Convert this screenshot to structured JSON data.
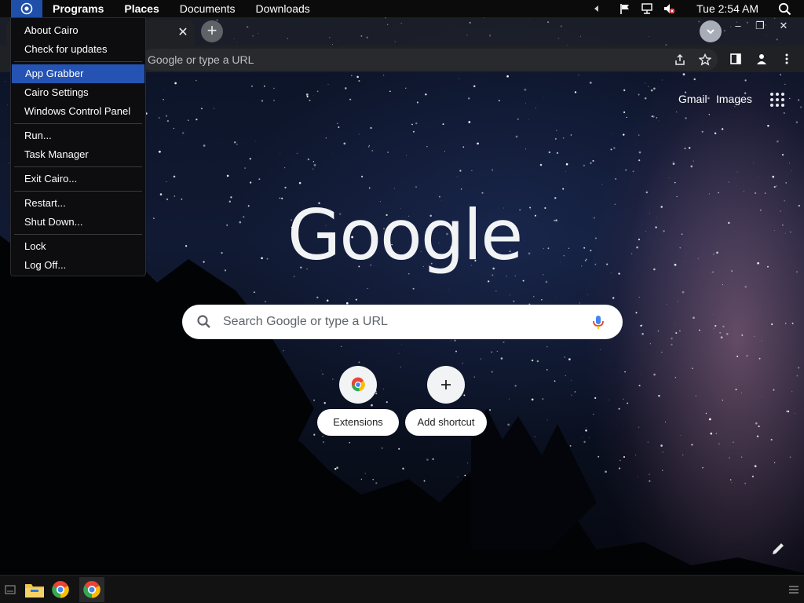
{
  "menubar": {
    "items": [
      "Programs",
      "Places",
      "Documents",
      "Downloads"
    ],
    "clock": "Tue 2:54 AM",
    "icons": [
      "cairo-logo-icon",
      "tray-expand-icon",
      "action-center-flag-icon",
      "network-icon",
      "volume-muted-icon",
      "search-icon"
    ]
  },
  "cairo_menu": {
    "groups": [
      [
        "About Cairo",
        "Check for updates"
      ],
      [
        "App Grabber",
        "Cairo Settings",
        "Windows Control Panel"
      ],
      [
        "Run...",
        "Task Manager"
      ],
      [
        "Exit Cairo..."
      ],
      [
        "Restart...",
        "Shut Down..."
      ],
      [
        "Lock",
        "Log Off..."
      ]
    ],
    "highlighted": "App Grabber"
  },
  "chrome": {
    "omnibox_placeholder": "Google or type a URL",
    "window_controls": [
      "–",
      "❐",
      "✕"
    ],
    "ntp": {
      "gmail": "Gmail",
      "images": "Images",
      "logo": "Google",
      "search_placeholder": "Search Google or type a URL",
      "shortcuts": [
        "Extensions",
        "Add shortcut"
      ]
    }
  },
  "colors": {
    "accent": "#2453b3",
    "menubar_bg": "#0b0b0b",
    "toolbar_bg": "#202124"
  },
  "taskbar": {
    "icons": [
      "show-desktop-icon",
      "file-explorer-icon",
      "chrome-icon",
      "chrome-icon",
      "taskbar-menu-icon"
    ]
  }
}
